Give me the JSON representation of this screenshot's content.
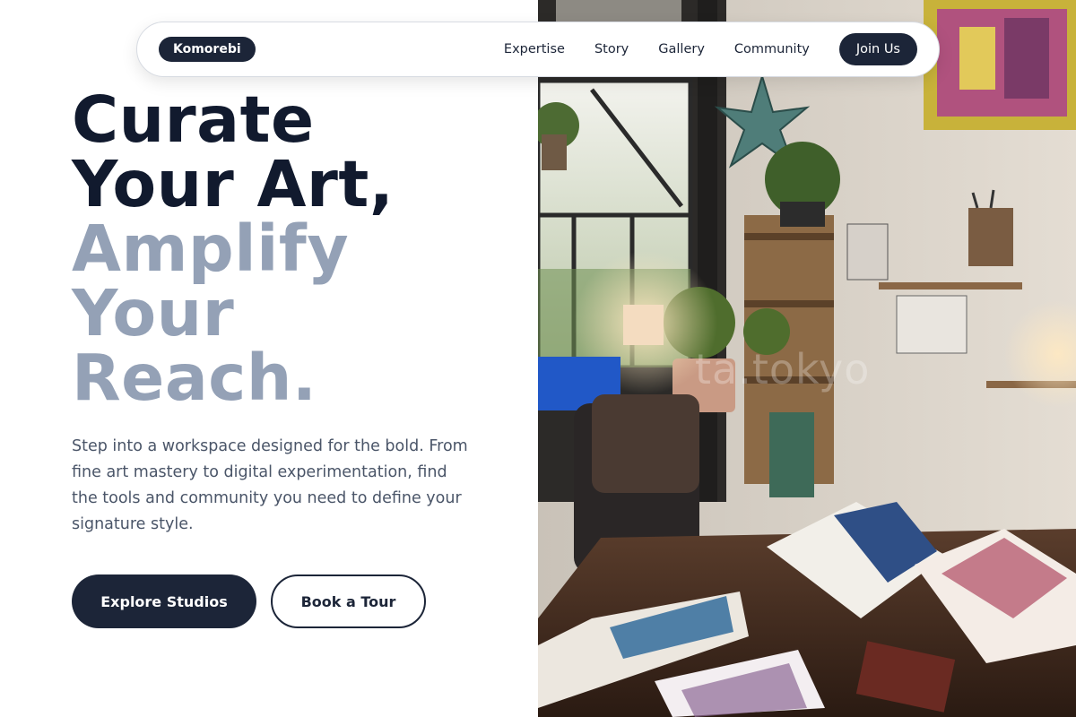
{
  "nav": {
    "brand": "Komorebi",
    "links": [
      "Expertise",
      "Story",
      "Gallery",
      "Community"
    ],
    "cta": "Join Us"
  },
  "hero": {
    "headline_dark_1": "Curate",
    "headline_dark_2": "Your Art,",
    "headline_light_1": "Amplify",
    "headline_light_2": "Your",
    "headline_light_3": "Reach.",
    "description": "Step into a workspace designed for the bold. From fine art mastery to digital experimentation, find the tools and community you need to define your signature style.",
    "primary_button": "Explore Studios",
    "secondary_button": "Book a Tour"
  },
  "image": {
    "watermark": "ta.tokyo"
  },
  "colors": {
    "navy": "#1c2538",
    "heading_dark": "#111a2e",
    "heading_light": "#94a1b6",
    "body_text": "#4a5568"
  }
}
